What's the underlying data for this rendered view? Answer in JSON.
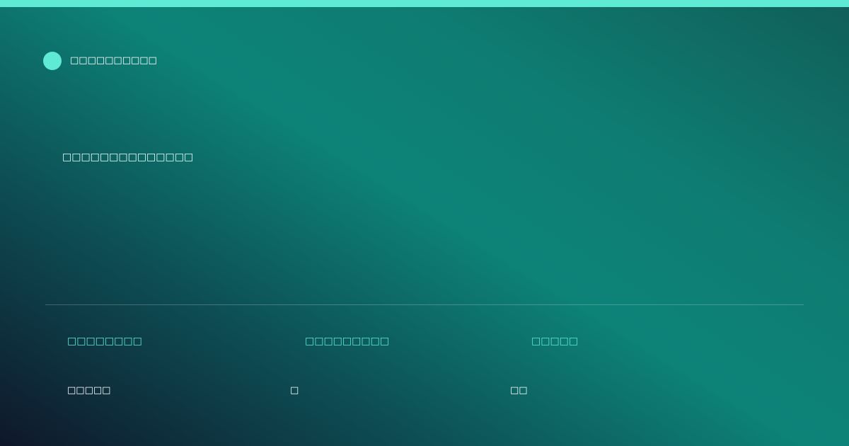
{
  "brand": {
    "name": "□□□□□□□□□□",
    "accent_color": "#5eead4"
  },
  "headline": "□□□□□□□□□□□□□□",
  "stats": [
    {
      "label": "□□□□□□□□",
      "value": "□□□□□"
    },
    {
      "label": "□□□□□□□□□",
      "value": "□"
    },
    {
      "label": "□□□□□",
      "value": "□□"
    }
  ],
  "colors": {
    "accent": "#5eead4",
    "background_start": "#0f172a",
    "background_mid": "#0d8378",
    "background_end": "#115e59",
    "text": "#ffffff"
  }
}
